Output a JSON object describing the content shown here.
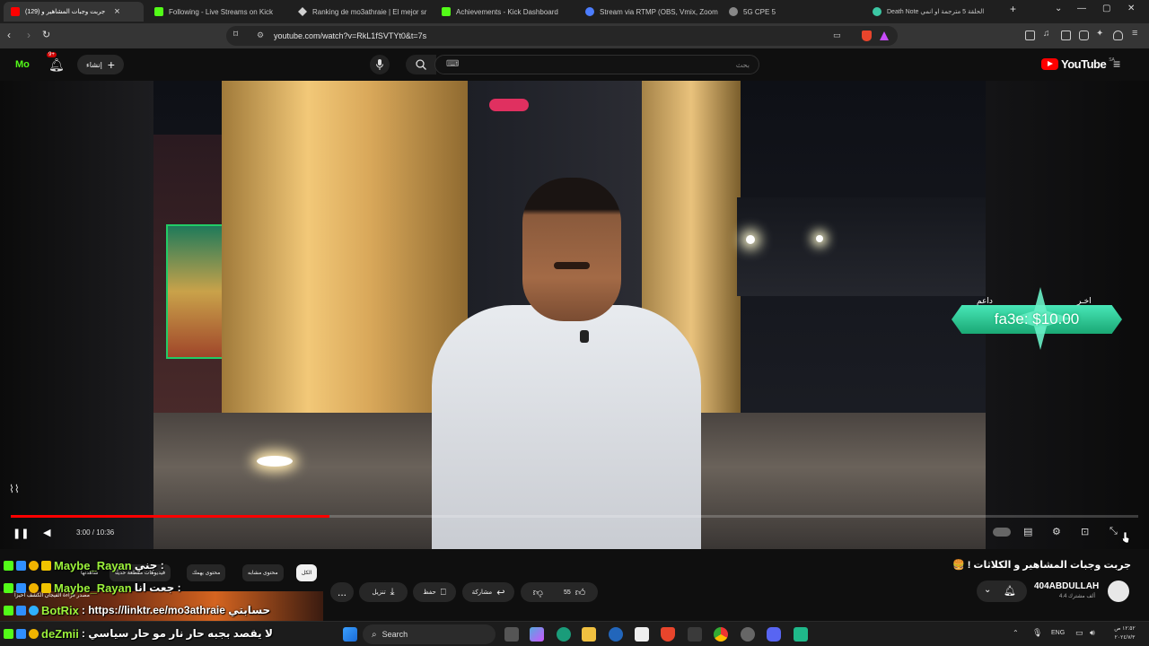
{
  "browser": {
    "tabs": [
      {
        "label": "(129) جربت وجبات المشاهير و",
        "active": true,
        "favicon_color": "#ff0000"
      },
      {
        "label": "Following - Live Streams on Kick",
        "active": false,
        "favicon_color": "#53fc18"
      },
      {
        "label": "Ranking de mo3athraie | El mejor sr",
        "active": false,
        "favicon_color": "#d0d0d0"
      },
      {
        "label": "Achievements - Kick Dashboard",
        "active": false,
        "favicon_color": "#53fc18"
      },
      {
        "label": "Stream via RTMP (OBS, Vmix, Zoom",
        "active": false,
        "favicon_color": "#4c7dff"
      },
      {
        "label": "5G CPE 5",
        "active": false,
        "favicon_color": "#888888"
      },
      {
        "label": "Death Note الحلقة 5 مترجمة او انمي",
        "active": false,
        "favicon_color": "#3cc7a4"
      }
    ],
    "new_tab": "+",
    "url": "youtube.com/watch?v=RkL1fSVTYt0&t=7s"
  },
  "youtube": {
    "logo_text": "YouTube",
    "logo_region": "SA",
    "create_label": "إنشاء",
    "notification_count": "9+",
    "search_placeholder": "بحث",
    "search_hint": "⌨"
  },
  "player": {
    "time_current": "3:00",
    "time_total": "10:36",
    "time_display": "3:00 / 10:36",
    "progress": 0.283,
    "donation": {
      "top_left": "داعم",
      "top_right": "اخـر",
      "amount": "fa3e: $10.00"
    }
  },
  "video": {
    "title": "جربت وجبات المشاهير و الكلاثات ! 🍔",
    "channel": "404ABDULLAH",
    "subscribers": "4.4 ألف مشترك",
    "likes": "55",
    "share_label": "مشاركة",
    "save_label": "حفظ",
    "download_label": "تنزيل",
    "more_label": "..."
  },
  "chips": [
    {
      "label": "الكل",
      "active": true
    },
    {
      "label": "محتوى مشابه",
      "active": false
    },
    {
      "label": "محتوى يهمك",
      "active": false
    },
    {
      "label": "فيديوهات مقطعة حديثًا",
      "active": false
    }
  ],
  "related_snippet": {
    "line1": "شاهدتها",
    "line2": "مصدر قراءة الفيجان الكشف أحيزاً"
  },
  "chat": [
    {
      "user": "Maybe_Rayan",
      "message": "جني :",
      "color": "#9cf23b"
    },
    {
      "user": "Maybe_Rayan",
      "message": "جعت انا :",
      "color": "#9cf23b"
    },
    {
      "user": "BotRix",
      "message": ": https://linktr.ee/mo3athraie حسابتي",
      "color": "#9cf23b"
    },
    {
      "user": "deZmii",
      "message": ": لا يقصد بجبه حار نار مو حار سياسي",
      "color": "#9cf23b"
    }
  ],
  "taskbar": {
    "search_label": "Search",
    "lang": "ENG",
    "clock_time": "١٢:٥٢ ص",
    "clock_date": "٢٠٢٤/٧/٣"
  },
  "colors": {
    "accent_red": "#ff0000",
    "kick_green": "#53fc18",
    "chat_username": "#9cf23b",
    "donation_teal": "#2ecf99"
  }
}
